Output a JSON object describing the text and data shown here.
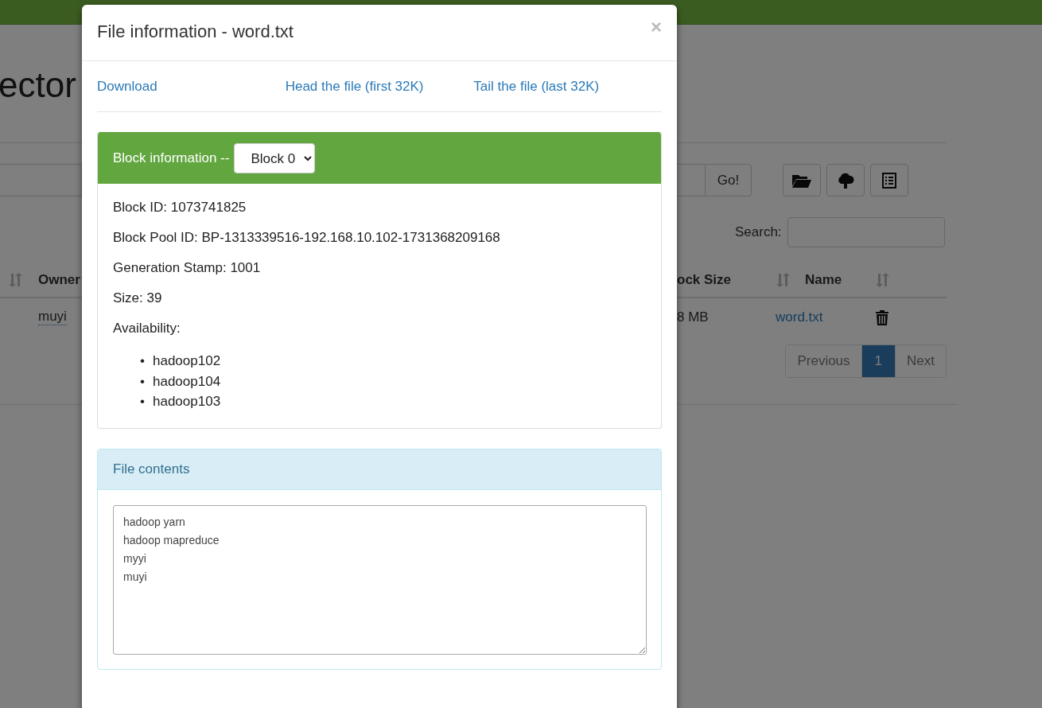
{
  "page": {
    "heading": "ector",
    "go_button": "Go!",
    "search_label": "Search:",
    "table": {
      "left_columns": [
        "Owner"
      ],
      "right_columns": [
        "ock Size",
        "Name"
      ],
      "row": {
        "owner": "muyi",
        "block_size": "8 MB",
        "name": "word.txt"
      }
    },
    "pagination": [
      {
        "label": "Previous",
        "selected": false
      },
      {
        "label": "1",
        "selected": true
      },
      {
        "label": "Next",
        "selected": false
      }
    ]
  },
  "modal": {
    "title": "File information - word.txt",
    "close": "×",
    "links": [
      "Download",
      "Head the file (first 32K)",
      "Tail the file (last 32K)"
    ],
    "block_panel": {
      "title": "Block information --",
      "select_value": "Block 0",
      "fields": [
        "Block ID: 1073741825",
        "Block Pool ID: BP-1313339516-192.168.10.102-1731368209168",
        "Generation Stamp: 1001",
        "Size: 39",
        "Availability:"
      ],
      "availability": [
        {
          "bullet": "•",
          "host": "hadoop102"
        },
        {
          "bullet": "•",
          "host": "hadoop104"
        },
        {
          "bullet": "•",
          "host": "hadoop103"
        }
      ]
    },
    "contents_panel": {
      "title": "File contents",
      "lines": [
        "hadoop yarn",
        "hadoop mapreduce",
        "myyi",
        "muyi"
      ]
    }
  }
}
